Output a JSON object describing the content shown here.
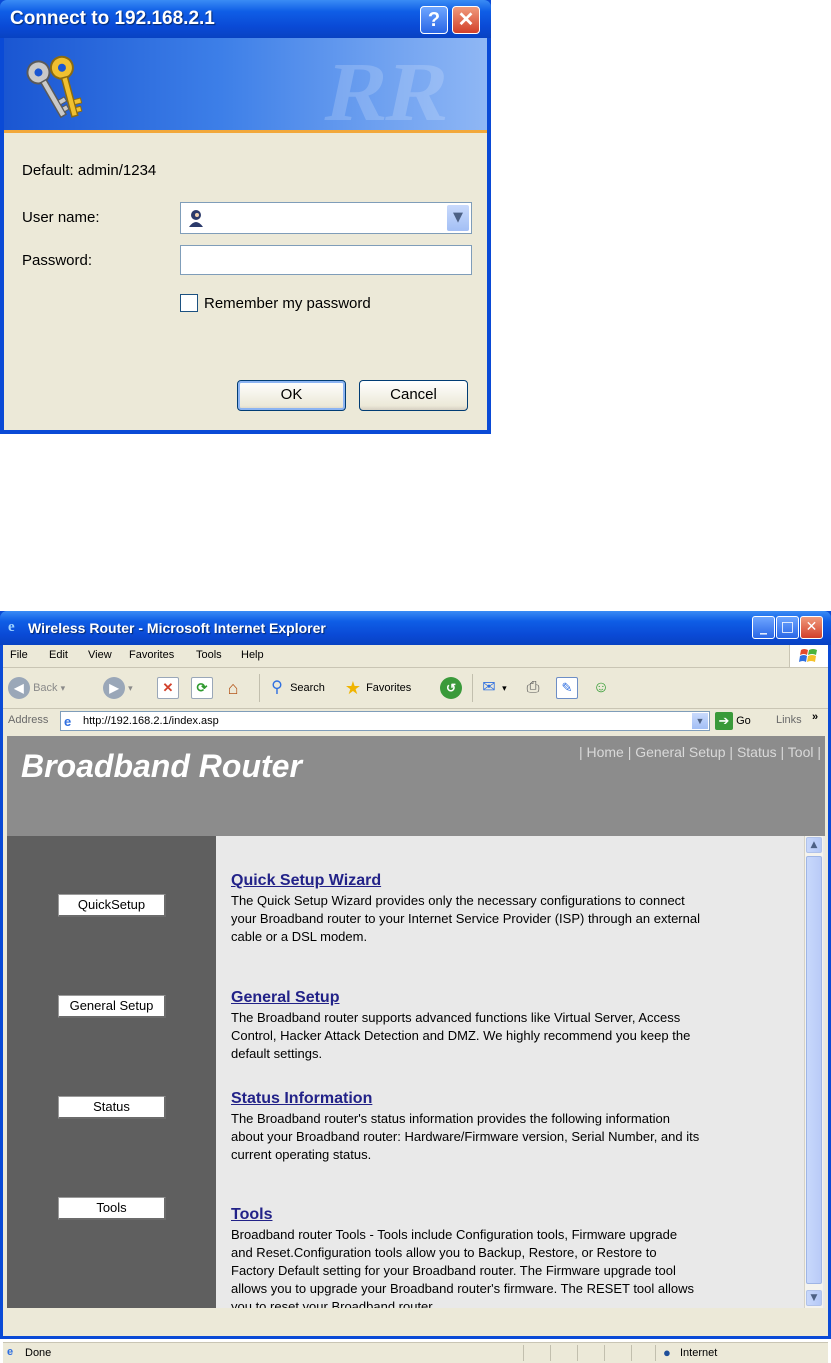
{
  "login_dialog": {
    "title": "Connect to 192.168.2.1",
    "help_label": "?",
    "close_label": "✕",
    "banner_ghost": "RR",
    "default_hint": "Default: admin/1234",
    "username_label": "User name:",
    "username_value": "",
    "password_label": "Password:",
    "password_value": "",
    "remember_label": "Remember my password",
    "remember_checked": false,
    "ok_label": "OK",
    "cancel_label": "Cancel"
  },
  "browser": {
    "title": "Wireless Router - Microsoft Internet Explorer",
    "menu": [
      "File",
      "Edit",
      "View",
      "Favorites",
      "Tools",
      "Help"
    ],
    "toolbar": {
      "back": "Back",
      "search": "Search",
      "favorites": "Favorites"
    },
    "address_label": "Address",
    "address_url": "http://192.168.2.1/index.asp",
    "go_label": "Go",
    "links_label": "Links",
    "status_left": "Done",
    "status_zone": "Internet"
  },
  "page": {
    "brand": "Broadband Router",
    "nav": "| Home | General Setup | Status | Tool |",
    "side_buttons": [
      "QuickSetup",
      "General Setup",
      "Status",
      "Tools"
    ],
    "sections": [
      {
        "heading": "Quick Setup Wizard",
        "text": "The Quick Setup Wizard provides only the necessary configurations to connect your Broadband router to your Internet Service Provider (ISP) through an external cable or a DSL modem."
      },
      {
        "heading": "General Setup",
        "text": "The Broadband router supports advanced functions like Virtual Server, Access Control, Hacker Attack Detection and DMZ. We highly recommend you keep the default settings."
      },
      {
        "heading": "Status Information",
        "text": "The Broadband router's status information provides the following information about your Broadband router: Hardware/Firmware version, Serial Number, and its current operating status."
      },
      {
        "heading": "Tools",
        "text": "Broadband router Tools - Tools include Configuration tools, Firmware upgrade and Reset.Configuration tools allow you to Backup, Restore, or Restore to Factory Default setting for your Broadband router. The Firmware upgrade tool allows you to upgrade your Broadband router's firmware. The RESET tool allows you to reset your Broadband router."
      }
    ]
  },
  "colors": {
    "xp_title_blue": "#0a4ad6",
    "dialog_face": "#ece9d8",
    "header_gray": "#8c8c8c",
    "sidebar_gray": "#5f5f5f",
    "link_blue": "#222288"
  }
}
